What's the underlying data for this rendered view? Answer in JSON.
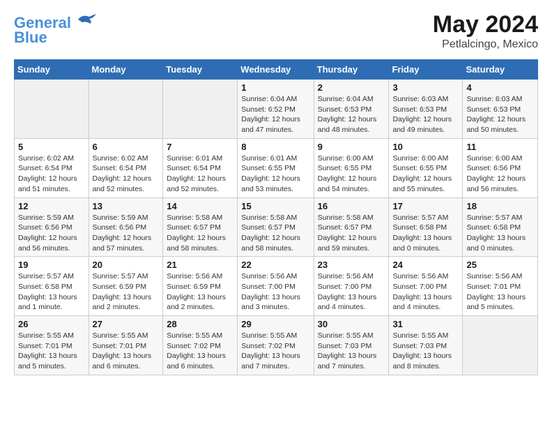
{
  "header": {
    "logo_line1": "General",
    "logo_line2": "Blue",
    "title": "May 2024",
    "subtitle": "Petlalcingo, Mexico"
  },
  "weekdays": [
    "Sunday",
    "Monday",
    "Tuesday",
    "Wednesday",
    "Thursday",
    "Friday",
    "Saturday"
  ],
  "weeks": [
    [
      {
        "day": "",
        "info": ""
      },
      {
        "day": "",
        "info": ""
      },
      {
        "day": "",
        "info": ""
      },
      {
        "day": "1",
        "info": "Sunrise: 6:04 AM\nSunset: 6:52 PM\nDaylight: 12 hours\nand 47 minutes."
      },
      {
        "day": "2",
        "info": "Sunrise: 6:04 AM\nSunset: 6:53 PM\nDaylight: 12 hours\nand 48 minutes."
      },
      {
        "day": "3",
        "info": "Sunrise: 6:03 AM\nSunset: 6:53 PM\nDaylight: 12 hours\nand 49 minutes."
      },
      {
        "day": "4",
        "info": "Sunrise: 6:03 AM\nSunset: 6:53 PM\nDaylight: 12 hours\nand 50 minutes."
      }
    ],
    [
      {
        "day": "5",
        "info": "Sunrise: 6:02 AM\nSunset: 6:54 PM\nDaylight: 12 hours\nand 51 minutes."
      },
      {
        "day": "6",
        "info": "Sunrise: 6:02 AM\nSunset: 6:54 PM\nDaylight: 12 hours\nand 52 minutes."
      },
      {
        "day": "7",
        "info": "Sunrise: 6:01 AM\nSunset: 6:54 PM\nDaylight: 12 hours\nand 52 minutes."
      },
      {
        "day": "8",
        "info": "Sunrise: 6:01 AM\nSunset: 6:55 PM\nDaylight: 12 hours\nand 53 minutes."
      },
      {
        "day": "9",
        "info": "Sunrise: 6:00 AM\nSunset: 6:55 PM\nDaylight: 12 hours\nand 54 minutes."
      },
      {
        "day": "10",
        "info": "Sunrise: 6:00 AM\nSunset: 6:55 PM\nDaylight: 12 hours\nand 55 minutes."
      },
      {
        "day": "11",
        "info": "Sunrise: 6:00 AM\nSunset: 6:56 PM\nDaylight: 12 hours\nand 56 minutes."
      }
    ],
    [
      {
        "day": "12",
        "info": "Sunrise: 5:59 AM\nSunset: 6:56 PM\nDaylight: 12 hours\nand 56 minutes."
      },
      {
        "day": "13",
        "info": "Sunrise: 5:59 AM\nSunset: 6:56 PM\nDaylight: 12 hours\nand 57 minutes."
      },
      {
        "day": "14",
        "info": "Sunrise: 5:58 AM\nSunset: 6:57 PM\nDaylight: 12 hours\nand 58 minutes."
      },
      {
        "day": "15",
        "info": "Sunrise: 5:58 AM\nSunset: 6:57 PM\nDaylight: 12 hours\nand 58 minutes."
      },
      {
        "day": "16",
        "info": "Sunrise: 5:58 AM\nSunset: 6:57 PM\nDaylight: 12 hours\nand 59 minutes."
      },
      {
        "day": "17",
        "info": "Sunrise: 5:57 AM\nSunset: 6:58 PM\nDaylight: 13 hours\nand 0 minutes."
      },
      {
        "day": "18",
        "info": "Sunrise: 5:57 AM\nSunset: 6:58 PM\nDaylight: 13 hours\nand 0 minutes."
      }
    ],
    [
      {
        "day": "19",
        "info": "Sunrise: 5:57 AM\nSunset: 6:58 PM\nDaylight: 13 hours\nand 1 minute."
      },
      {
        "day": "20",
        "info": "Sunrise: 5:57 AM\nSunset: 6:59 PM\nDaylight: 13 hours\nand 2 minutes."
      },
      {
        "day": "21",
        "info": "Sunrise: 5:56 AM\nSunset: 6:59 PM\nDaylight: 13 hours\nand 2 minutes."
      },
      {
        "day": "22",
        "info": "Sunrise: 5:56 AM\nSunset: 7:00 PM\nDaylight: 13 hours\nand 3 minutes."
      },
      {
        "day": "23",
        "info": "Sunrise: 5:56 AM\nSunset: 7:00 PM\nDaylight: 13 hours\nand 4 minutes."
      },
      {
        "day": "24",
        "info": "Sunrise: 5:56 AM\nSunset: 7:00 PM\nDaylight: 13 hours\nand 4 minutes."
      },
      {
        "day": "25",
        "info": "Sunrise: 5:56 AM\nSunset: 7:01 PM\nDaylight: 13 hours\nand 5 minutes."
      }
    ],
    [
      {
        "day": "26",
        "info": "Sunrise: 5:55 AM\nSunset: 7:01 PM\nDaylight: 13 hours\nand 5 minutes."
      },
      {
        "day": "27",
        "info": "Sunrise: 5:55 AM\nSunset: 7:01 PM\nDaylight: 13 hours\nand 6 minutes."
      },
      {
        "day": "28",
        "info": "Sunrise: 5:55 AM\nSunset: 7:02 PM\nDaylight: 13 hours\nand 6 minutes."
      },
      {
        "day": "29",
        "info": "Sunrise: 5:55 AM\nSunset: 7:02 PM\nDaylight: 13 hours\nand 7 minutes."
      },
      {
        "day": "30",
        "info": "Sunrise: 5:55 AM\nSunset: 7:03 PM\nDaylight: 13 hours\nand 7 minutes."
      },
      {
        "day": "31",
        "info": "Sunrise: 5:55 AM\nSunset: 7:03 PM\nDaylight: 13 hours\nand 8 minutes."
      },
      {
        "day": "",
        "info": ""
      }
    ]
  ]
}
